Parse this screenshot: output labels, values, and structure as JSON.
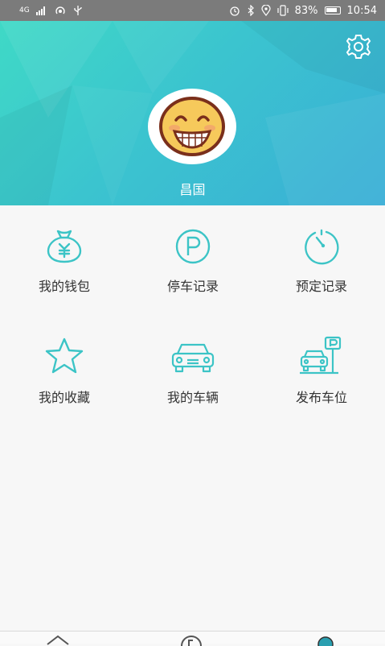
{
  "status_bar": {
    "network": "4G",
    "battery": "83%",
    "time": "10:54"
  },
  "profile": {
    "username": "昌国",
    "settings_icon": "gear-icon",
    "avatar_icon": "smiley-face-icon"
  },
  "colors": {
    "accent": "#3cc4c6",
    "header_start": "#3fd9c6",
    "header_end": "#3aaed6"
  },
  "menu": {
    "items": [
      {
        "label": "我的钱包",
        "icon": "money-bag-icon"
      },
      {
        "label": "停车记录",
        "icon": "parking-icon"
      },
      {
        "label": "预定记录",
        "icon": "clock-icon"
      },
      {
        "label": "我的收藏",
        "icon": "star-icon"
      },
      {
        "label": "我的车辆",
        "icon": "car-icon"
      },
      {
        "label": "发布车位",
        "icon": "parking-sign-car-icon"
      }
    ]
  },
  "bottom_nav": {
    "items": [
      {
        "icon": "home-icon"
      },
      {
        "icon": "parking-icon"
      },
      {
        "icon": "profile-icon"
      }
    ]
  }
}
